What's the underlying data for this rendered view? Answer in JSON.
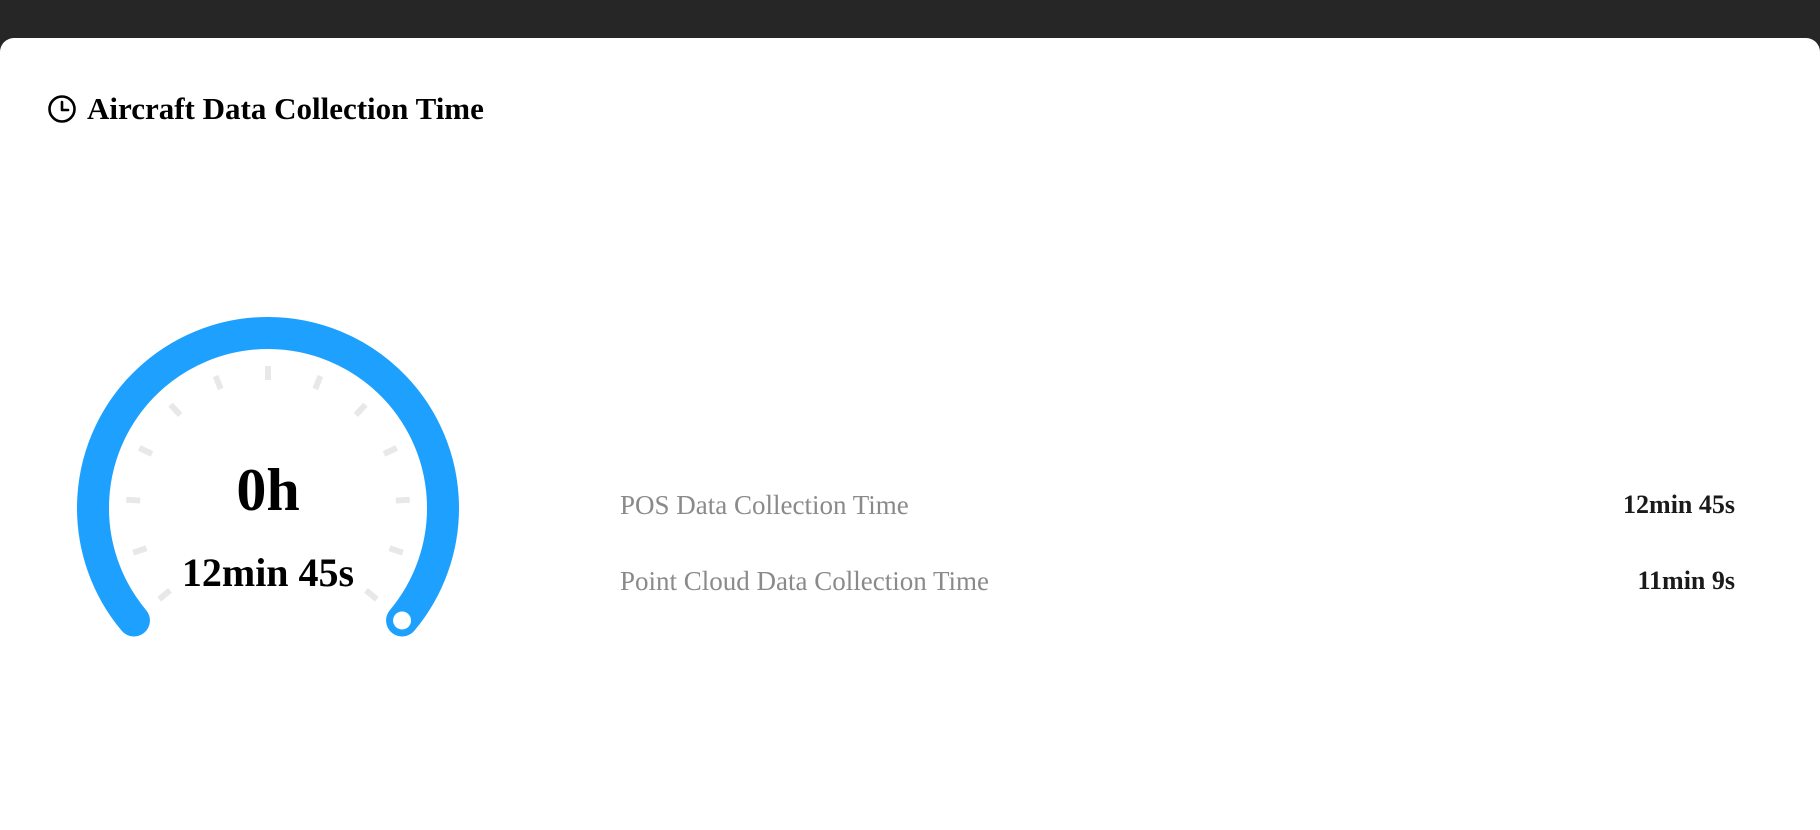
{
  "panel": {
    "title": "Aircraft Data Collection Time",
    "icon": "clock-icon"
  },
  "gauge": {
    "hours_label": "0h",
    "minutes_label": "12min 45s",
    "accent_color": "#1ea0ff",
    "tick_color": "#e8e8e8"
  },
  "stats": [
    {
      "label": "POS Data Collection Time",
      "value": "12min 45s"
    },
    {
      "label": "Point Cloud Data Collection Time",
      "value": "11min 9s"
    }
  ],
  "colors": {
    "top_bar": "#262626",
    "card_background": "#ffffff",
    "label_gray": "#8a8a8a"
  }
}
